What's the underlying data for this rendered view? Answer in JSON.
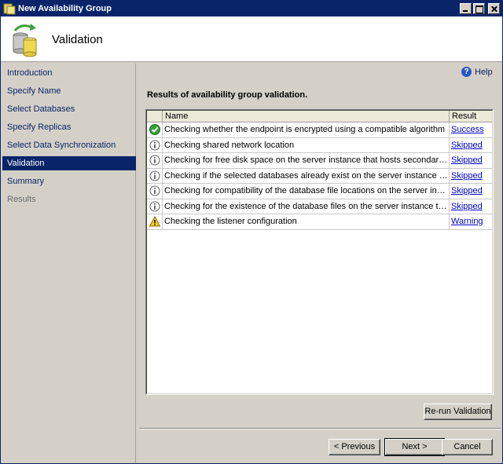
{
  "window": {
    "title": "New Availability Group"
  },
  "header": {
    "title": "Validation"
  },
  "nav": {
    "items": [
      {
        "label": "Introduction",
        "state": "normal"
      },
      {
        "label": "Specify Name",
        "state": "normal"
      },
      {
        "label": "Select Databases",
        "state": "normal"
      },
      {
        "label": "Specify Replicas",
        "state": "normal"
      },
      {
        "label": "Select Data Synchronization",
        "state": "normal"
      },
      {
        "label": "Validation",
        "state": "selected"
      },
      {
        "label": "Summary",
        "state": "normal"
      },
      {
        "label": "Results",
        "state": "disabled"
      }
    ]
  },
  "help": {
    "label": "Help"
  },
  "main": {
    "section_title": "Results of availability group validation.",
    "grid": {
      "columns": [
        "Name",
        "Result"
      ],
      "rows": [
        {
          "icon": "success-icon",
          "name": "Checking whether the endpoint is encrypted using a compatible algorithm",
          "result": "Success"
        },
        {
          "icon": "info-icon",
          "name": "Checking shared network location",
          "result": "Skipped"
        },
        {
          "icon": "info-icon",
          "name": "Checking for free disk space on the server instance that hosts secondary replica ...",
          "result": "Skipped"
        },
        {
          "icon": "info-icon",
          "name": "Checking if the selected databases already exist on the server instance that host...",
          "result": "Skipped"
        },
        {
          "icon": "info-icon",
          "name": "Checking for compatibility of the database file locations on the server instance th...",
          "result": "Skipped"
        },
        {
          "icon": "info-icon",
          "name": "Checking for the existence of the database files on the server instance that host...",
          "result": "Skipped"
        },
        {
          "icon": "warning-icon",
          "name": "Checking the listener configuration",
          "result": "Warning"
        }
      ]
    },
    "rerun_label": "Re-run Validation"
  },
  "footer": {
    "previous_label": "< Previous",
    "next_label": "Next >",
    "cancel_label": "Cancel"
  },
  "colors": {
    "titlebar": "#0a246a",
    "selected_nav": "#0a246a",
    "link": "#0000cc",
    "face": "#d4d0c8"
  }
}
